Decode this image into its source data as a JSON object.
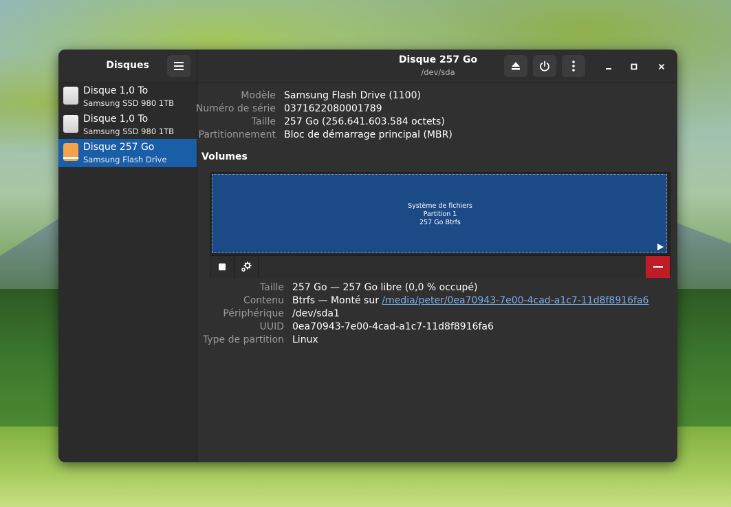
{
  "sidebar": {
    "title": "Disques",
    "drives": [
      {
        "name": "Disque 1,0 To",
        "subtitle": "Samsung SSD 980 1TB",
        "icon": "ssd-drive-icon"
      },
      {
        "name": "Disque 1,0 To",
        "subtitle": "Samsung SSD 980 1TB",
        "icon": "ssd-drive-icon"
      },
      {
        "name": "Disque 257 Go",
        "subtitle": "Samsung Flash Drive",
        "icon": "usb-drive-icon",
        "selected": true
      }
    ]
  },
  "header": {
    "title": "Disque 257 Go",
    "subtitle": "/dev/sda"
  },
  "drive_info": {
    "model_label": "Modèle",
    "model_value": "Samsung Flash Drive (1100)",
    "serial_label": "Numéro de série",
    "serial_value": "0371622080001789",
    "size_label": "Taille",
    "size_value": "257 Go (256.641.603.584 octets)",
    "partitioning_label": "Partitionnement",
    "partitioning_value": "Bloc de démarrage principal (MBR)"
  },
  "volumes": {
    "title": "Volumes",
    "partition": {
      "line1": "Système de fichiers",
      "line2": "Partition 1",
      "line3": "257 Go Btrfs"
    }
  },
  "volume_info": {
    "size_label": "Taille",
    "size_value": "257 Go — 257 Go libre (0,0 % occupé)",
    "contents_label": "Contenu",
    "contents_prefix": "Btrfs — Monté sur ",
    "contents_link": "/media/peter/0ea70943-7e00-4cad-a1c7-11d8f8916fa6",
    "device_label": "Périphérique",
    "device_value": "/dev/sda1",
    "uuid_label": "UUID",
    "uuid_value": "0ea70943-7e00-4cad-a1c7-11d8f8916fa6",
    "type_label": "Type de partition",
    "type_value": "Linux"
  },
  "colors": {
    "accent": "#1a5ea8",
    "partition_fill": "#1c4a86",
    "destructive": "#c01c28",
    "link": "#78aeed"
  }
}
